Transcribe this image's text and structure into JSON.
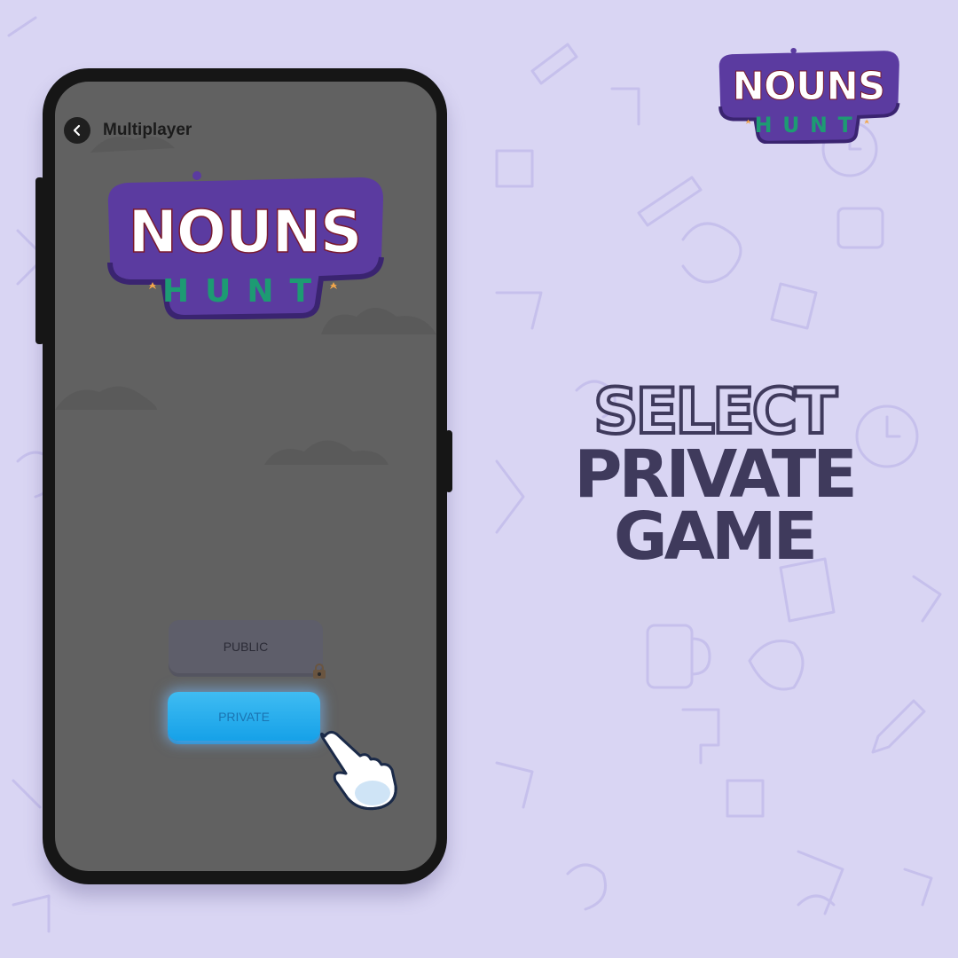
{
  "logo": {
    "line1": "NOUNS",
    "line2": "HUNT"
  },
  "headline": {
    "line1": "SELECT",
    "line2": "PRIVATE",
    "line3": "GAME"
  },
  "phone_screen": {
    "title": "Multiplayer",
    "buttons": {
      "public_label": "PUBLIC",
      "private_label": "PRIVATE"
    }
  },
  "colors": {
    "background": "#d9d5f3",
    "headline": "#3f3a5c",
    "screen": "#616161",
    "private_button": "#21aaeb",
    "logo_purple": "#5b3ba0",
    "logo_green": "#1d9b73"
  },
  "icons": [
    "back-arrow-icon",
    "lock-icon",
    "pointing-hand-icon"
  ]
}
